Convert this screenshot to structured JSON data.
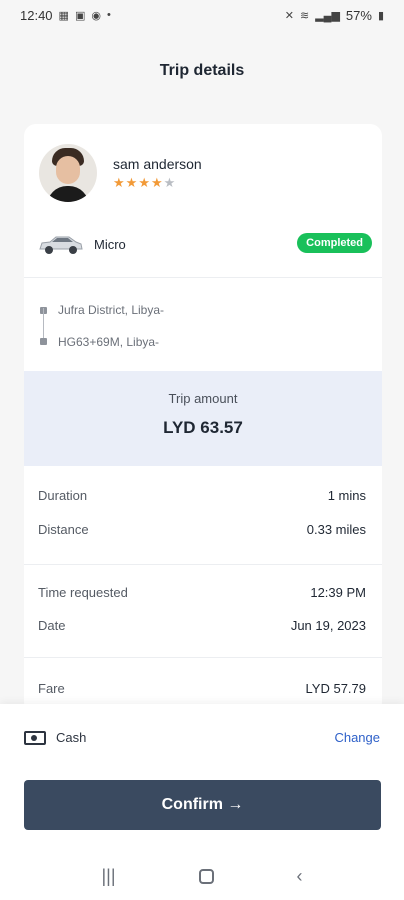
{
  "status_bar": {
    "time": "12:40",
    "icons_left": [
      "sim-data-icon",
      "image-icon",
      "target-icon",
      "dot-icon"
    ],
    "battery": "57%"
  },
  "header": {
    "title": "Trip details"
  },
  "driver": {
    "name": "sam anderson",
    "rating_stars": 4,
    "rating_max": 5
  },
  "vehicle": {
    "type": "Micro",
    "status": "Completed"
  },
  "route": {
    "pickup": "Jufra District, Libya-",
    "dropoff": "HG63+69M, Libya-"
  },
  "amount": {
    "label": "Trip amount",
    "value": "LYD 63.57"
  },
  "details": [
    {
      "label": "Duration",
      "value": "1 mins"
    },
    {
      "label": "Distance",
      "value": "0.33 miles"
    },
    {
      "label": "Time requested",
      "value": "12:39 PM"
    },
    {
      "label": "Date",
      "value": "Jun 19, 2023"
    },
    {
      "label": "Fare",
      "value": "LYD 57.79"
    }
  ],
  "payment": {
    "method": "Cash",
    "change_label": "Change"
  },
  "confirm_button": {
    "label": "Confirm →"
  },
  "colors": {
    "accent": "#3a4a60",
    "success": "#19c05a",
    "link": "#2f61c9",
    "star": "#f29a38"
  }
}
